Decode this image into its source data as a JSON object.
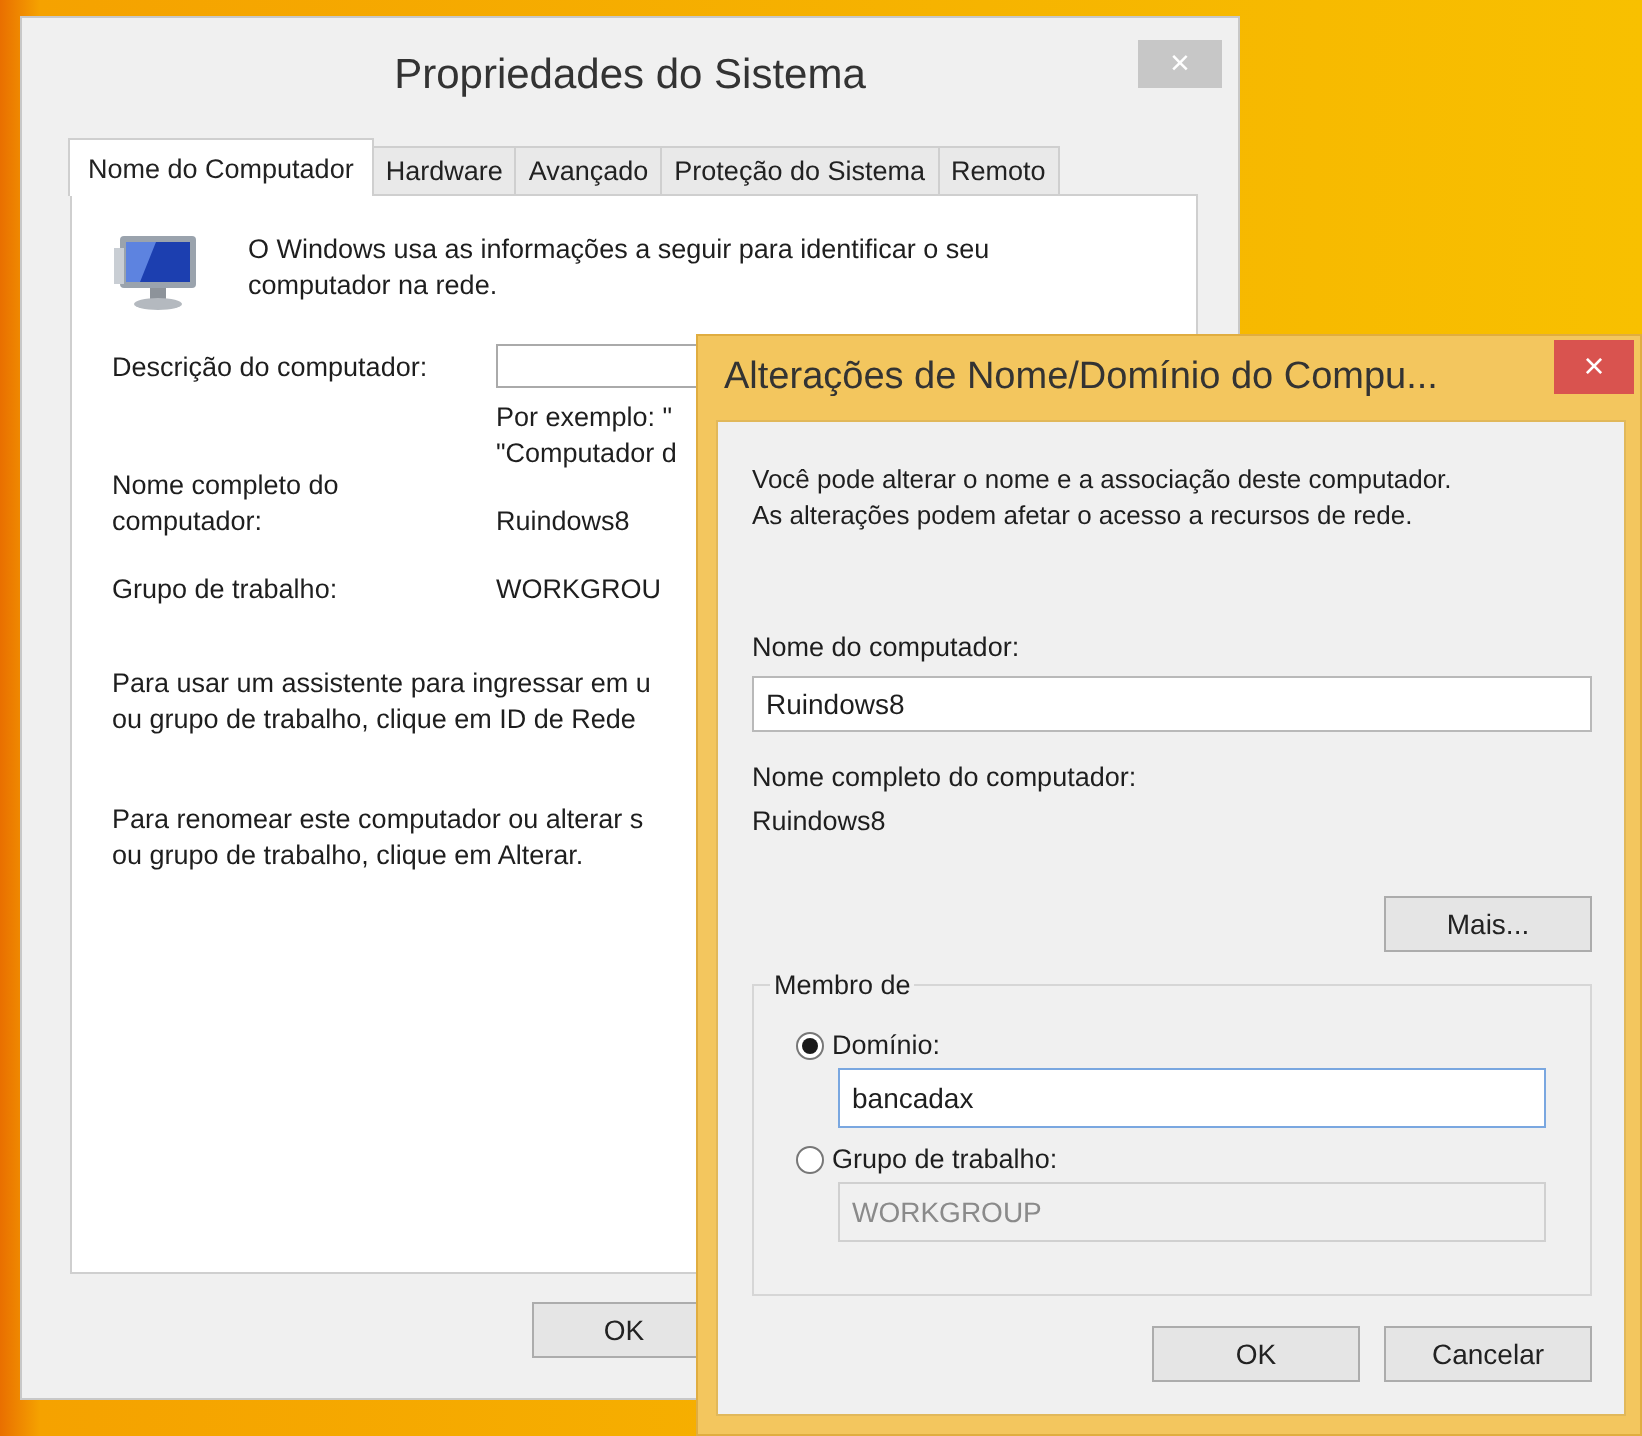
{
  "back_window": {
    "title": "Propriedades do Sistema",
    "close": "×",
    "tabs": [
      {
        "label": "Nome do Computador",
        "selected": true
      },
      {
        "label": "Hardware",
        "selected": false
      },
      {
        "label": "Avançado",
        "selected": false
      },
      {
        "label": "Proteção do Sistema",
        "selected": false
      },
      {
        "label": "Remoto",
        "selected": false
      }
    ],
    "intro": "O Windows usa as informações a seguir para identificar o seu\ncomputador na rede.",
    "description_label": "Descrição do computador:",
    "example": "Por exemplo: \"\n\"Computador d",
    "full_name_label": "Nome completo do\ncomputador:",
    "full_name": "Ruindows8",
    "workgroup_label": "Grupo de trabalho:",
    "workgroup": "WORKGROU",
    "network_id_text": "Para usar um assistente para ingressar em u\nou grupo de trabalho, clique em ID de Rede",
    "rename_text": "Para renomear este computador ou alterar s\nou grupo de trabalho, clique em Alterar.",
    "buttons": [
      "OK"
    ]
  },
  "dialog": {
    "title": "Alterações de Nome/Domínio do Compu...",
    "close": "×",
    "description": "Você pode alterar o nome e a associação deste computador.\nAs alterações podem afetar o acesso a recursos de rede.",
    "computer_name_label": "Nome do computador:",
    "computer_name": "Ruindows8",
    "full_name_label": "Nome completo do computador:",
    "full_name": "Ruindows8",
    "more_button": "Mais...",
    "member_of": {
      "legend": "Membro de",
      "options": [
        {
          "label": "Domínio:",
          "selected": true,
          "value": "bancadax",
          "disabled": false
        },
        {
          "label": "Grupo de trabalho:",
          "selected": false,
          "value": "WORKGROUP",
          "disabled": true
        }
      ]
    },
    "buttons": [
      "OK",
      "Cancelar"
    ]
  }
}
